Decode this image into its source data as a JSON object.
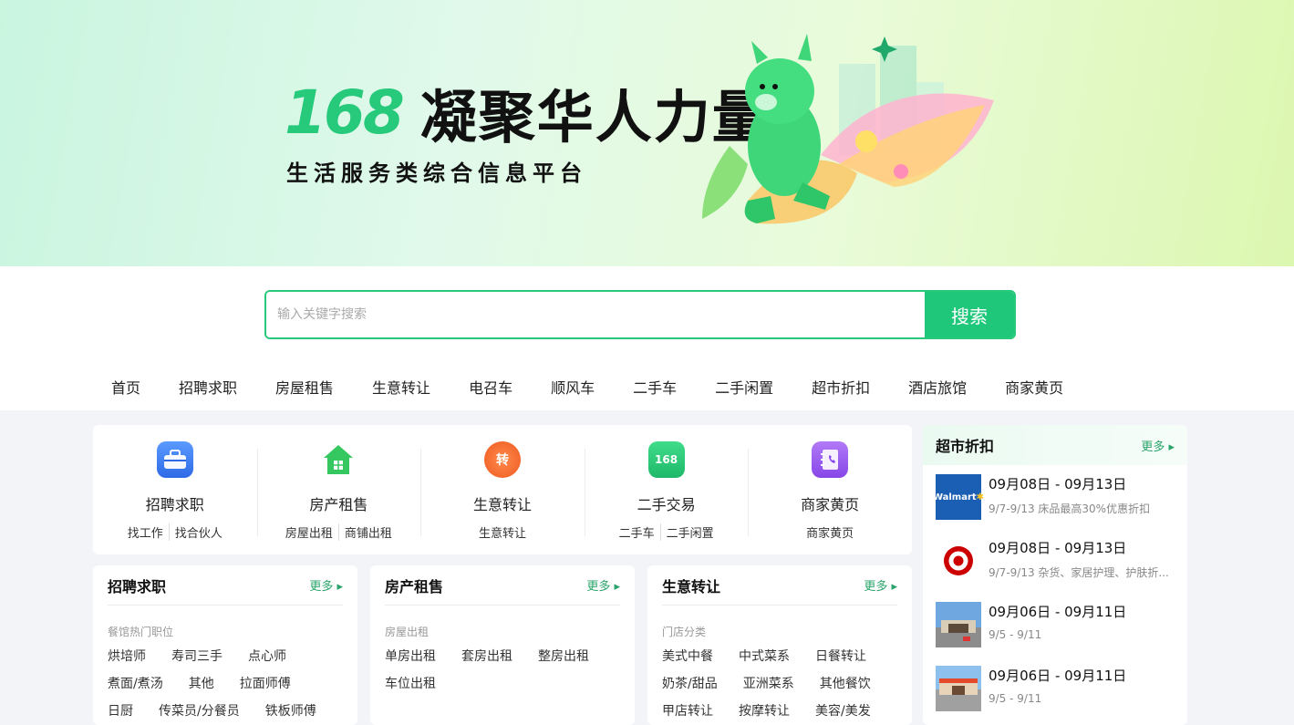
{
  "banner": {
    "number": "168",
    "slogan": "凝聚华人力量",
    "subtitle": "生活服务类综合信息平台"
  },
  "search": {
    "placeholder": "输入关键字搜索",
    "button_label": "搜索"
  },
  "nav": [
    "首页",
    "招聘求职",
    "房屋租售",
    "生意转让",
    "电召车",
    "顺风车",
    "二手车",
    "二手闲置",
    "超市折扣",
    "酒店旅馆",
    "商家黄页"
  ],
  "categories": [
    {
      "title": "招聘求职",
      "subs": [
        "找工作",
        "找合伙人"
      ],
      "icon": "briefcase-icon",
      "color": "#3d7cf0"
    },
    {
      "title": "房产租售",
      "subs": [
        "房屋出租",
        "商铺出租"
      ],
      "icon": "house-icon",
      "color": "#2fbf5d"
    },
    {
      "title": "生意转让",
      "subs": [
        "生意转让"
      ],
      "icon": "transfer-icon",
      "icon_text": "转",
      "color": "#f26a2e"
    },
    {
      "title": "二手交易",
      "subs": [
        "二手车",
        "二手闲置"
      ],
      "icon": "secondhand-icon",
      "icon_text": "168",
      "color": "#27c97a"
    },
    {
      "title": "商家黄页",
      "subs": [
        "商家黄页"
      ],
      "icon": "phonebook-icon",
      "color": "#9b5cf0"
    }
  ],
  "panels": [
    {
      "title": "招聘求职",
      "more": "更多",
      "subtitle": "餐馆热门职位",
      "links": [
        "烘培师",
        "寿司三手",
        "点心师",
        "煮面/煮汤",
        "其他",
        "拉面师傅",
        "日厨",
        "传菜员/分餐员",
        "铁板师傅"
      ]
    },
    {
      "title": "房产租售",
      "more": "更多",
      "subtitle": "房屋出租",
      "links": [
        "单房出租",
        "套房出租",
        "整房出租",
        "车位出租"
      ]
    },
    {
      "title": "生意转让",
      "more": "更多",
      "subtitle": "门店分类",
      "links": [
        "美式中餐",
        "中式菜系",
        "日餐转让",
        "奶茶/甜品",
        "亚洲菜系",
        "其他餐饮",
        "甲店转让",
        "按摩转让",
        "美容/美发"
      ]
    }
  ],
  "supermarket": {
    "title": "超市折扣",
    "more": "更多",
    "deals": [
      {
        "date": "09月08日 - 09月13日",
        "desc": "9/7-9/13 床品最高30%优惠折扣",
        "logo": "walmart-logo",
        "logo_text": "Walmart"
      },
      {
        "date": "09月08日 - 09月13日",
        "desc": "9/7-9/13 杂货、家居护理、护肤折...",
        "logo": "target-logo"
      },
      {
        "date": "09月06日 - 09月11日",
        "desc": "9/5 - 9/11",
        "logo": "store-photo"
      },
      {
        "date": "09月06日 - 09月11日",
        "desc": "9/5 - 9/11",
        "logo": "store-photo"
      }
    ]
  }
}
